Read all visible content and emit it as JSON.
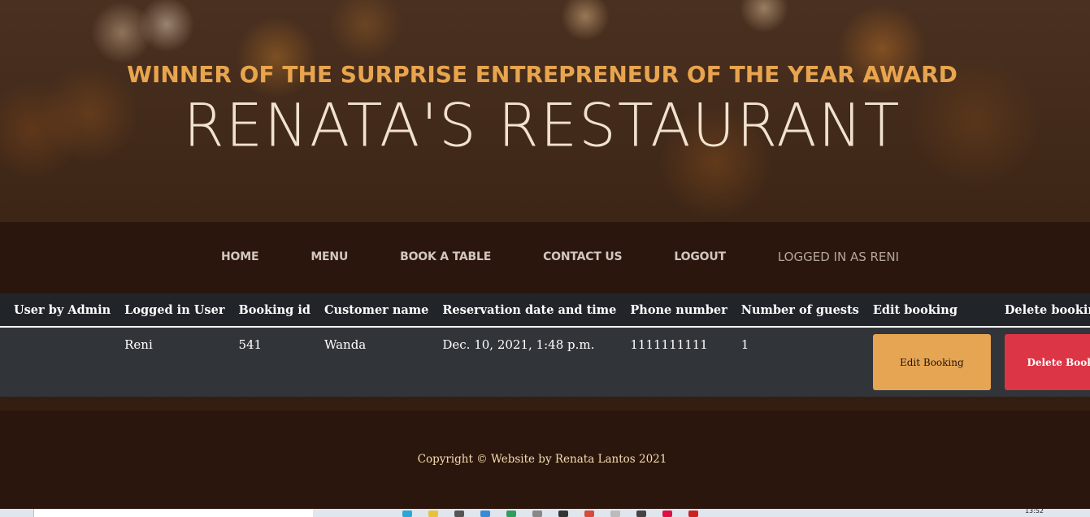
{
  "header": {
    "award": "WINNER OF THE SURPRISE ENTREPRENEUR OF THE YEAR AWARD",
    "brand": "RENATA'S RESTAURANT"
  },
  "nav": {
    "items": [
      {
        "label": "HOME"
      },
      {
        "label": "MENU"
      },
      {
        "label": "BOOK A TABLE"
      },
      {
        "label": "CONTACT US"
      },
      {
        "label": "LOGOUT"
      }
    ],
    "status": "LOGGED IN AS RENI"
  },
  "table": {
    "headers": [
      "User by Admin",
      "Logged in User",
      "Booking id",
      "Customer name",
      "Reservation date and time",
      "Phone number",
      "Number of guests",
      "Edit booking",
      "Delete booking"
    ],
    "rows": [
      {
        "user_by_admin": "",
        "logged_in_user": "Reni",
        "booking_id": "541",
        "customer_name": "Wanda",
        "reservation": "Dec. 10, 2021, 1:48 p.m.",
        "phone": "1111111111",
        "guests": "1",
        "edit_label": "Edit Booking",
        "delete_label": "Delete Booking"
      }
    ]
  },
  "footer": {
    "copyright": "Copyright © Website by Renata Lantos 2021"
  },
  "taskbar": {
    "clock": "13:52"
  },
  "colors": {
    "accent": "#e8a54e",
    "edit_button": "#e6a553",
    "delete_button": "#dc3545",
    "table_header": "#212529",
    "table_row": "#31353a",
    "nav_bg": "#2b160d"
  }
}
